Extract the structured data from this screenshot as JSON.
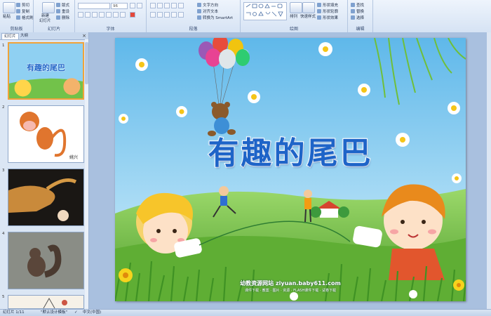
{
  "ribbon": {
    "groups": {
      "clipboard": "剪贴板",
      "slides": "幻灯片",
      "font": "字体",
      "paragraph": "段落",
      "drawing": "绘图",
      "editing": "编辑"
    },
    "clipboard": {
      "paste": "粘贴",
      "cut": "剪切",
      "copy": "复制",
      "format_painter": "格式刷"
    },
    "slides": {
      "new_slide": "新建",
      "new_slide2": "幻灯片",
      "layout": "版式",
      "reset": "重设",
      "delete": "删除"
    },
    "font": {
      "font_name": "",
      "font_size": "96"
    },
    "paragraph": {
      "text_direction": "文字方向",
      "align_text": "对齐文本",
      "smartart": "转换为 SmartArt"
    },
    "drawing": {
      "arrange": "排列",
      "quick_styles": "快速样式",
      "shape_fill": "形状填充",
      "shape_outline": "形状轮廓",
      "shape_effects": "形状效果"
    },
    "editing": {
      "find": "查找",
      "replace": "替换",
      "select": "选择"
    }
  },
  "panel": {
    "tabs": {
      "slides": "幻灯片",
      "outline": "大纲"
    },
    "close": "×",
    "slides": [
      {
        "num": "1",
        "name": "slide-1",
        "thumb_title": "有趣的尾巴"
      },
      {
        "num": "2",
        "name": "slide-2",
        "thumb_caption": "姚兴"
      },
      {
        "num": "3",
        "name": "slide-3"
      },
      {
        "num": "4",
        "name": "slide-4"
      },
      {
        "num": "5",
        "name": "slide-5"
      }
    ]
  },
  "slide": {
    "title": "有趣的尾巴",
    "watermark": "幼教资源网站 ziyuan.baby611.com",
    "watermark_sub": "课件下载 · 教案 · 图片 · 资源 · FLASH课件下载 · 试卷下载"
  },
  "status": {
    "slide_counter": "幻灯片 1/11",
    "theme": "\"默认设计模板\"",
    "language": "中文(中国)"
  },
  "colors": {
    "accent": "#1e64c8",
    "ribbon": "#d6e3f4",
    "selection": "#f1a33a"
  }
}
